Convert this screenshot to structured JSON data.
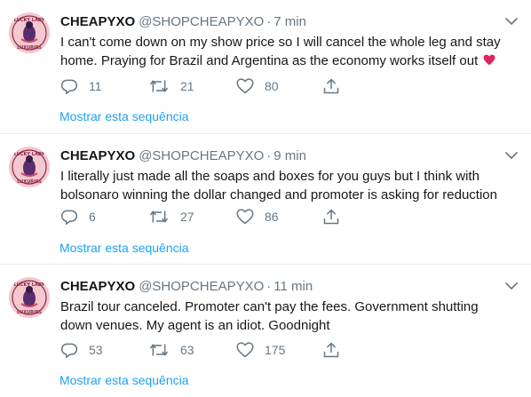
{
  "colors": {
    "text": "#14171a",
    "muted": "#657786",
    "link": "#1da1f2",
    "divider": "#e6ecf0",
    "heart_emoji": "#e0245e",
    "avatar_bg": "#f4c8cf"
  },
  "avatar": {
    "logo_text_top": "LUCKY LADY",
    "logo_text_bottom": "LUXURIES"
  },
  "tweets": [
    {
      "name": "CHEAPYXO",
      "handle": "@SHOPCHEAPYXO",
      "separator": "·",
      "time": "7 min",
      "text": "I can't come down on my show price so I will cancel the whole leg and stay home. Praying for Brazil and Argentina as the economy works itself out",
      "emoji": "heart-emoji",
      "replies": "11",
      "retweets": "21",
      "likes": "80",
      "thread_link": "Mostrar esta sequência"
    },
    {
      "name": "CHEAPYXO",
      "handle": "@SHOPCHEAPYXO",
      "separator": "·",
      "time": "9 min",
      "text": "I literally just made all the soaps and boxes for you guys but I think with bolsonaro winning the dollar changed and promoter is asking for reduction",
      "replies": "6",
      "retweets": "27",
      "likes": "86",
      "thread_link": "Mostrar esta sequência"
    },
    {
      "name": "CHEAPYXO",
      "handle": "@SHOPCHEAPYXO",
      "separator": "·",
      "time": "11 min",
      "text": "Brazil tour canceled. Promoter can't pay the fees. Government shutting down venues. My agent is an idiot. Goodnight",
      "replies": "53",
      "retweets": "63",
      "likes": "175",
      "thread_link": "Mostrar esta sequência"
    }
  ]
}
